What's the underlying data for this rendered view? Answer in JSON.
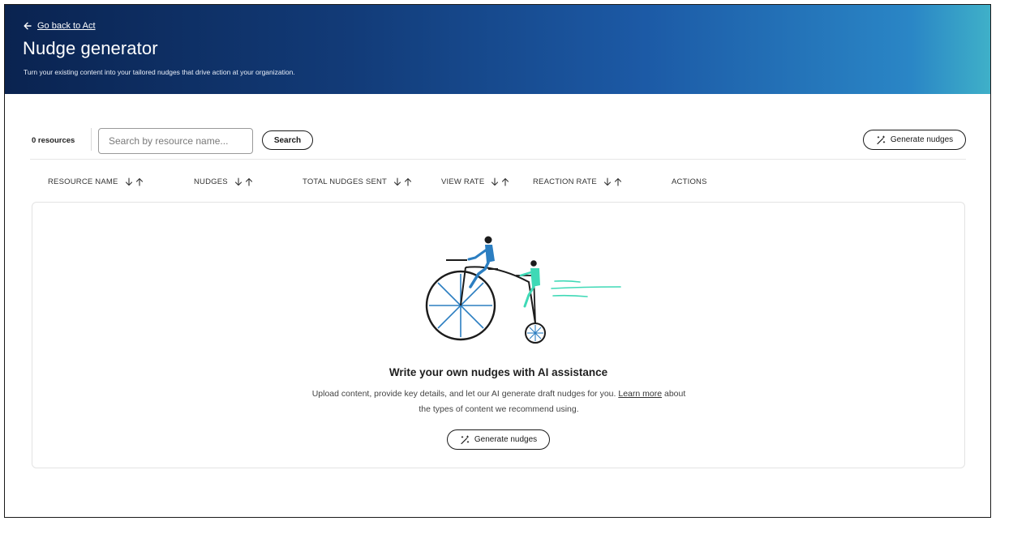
{
  "header": {
    "back_link": "Go back to Act",
    "title": "Nudge generator",
    "subtitle": "Turn your existing content into your tailored nudges that drive action at your organization."
  },
  "toolbar": {
    "resource_count": "0 resources",
    "search_placeholder": "Search by resource name...",
    "search_button": "Search",
    "generate_button": "Generate nudges"
  },
  "table": {
    "columns": [
      "RESOURCE NAME",
      "NUDGES",
      "TOTAL NUDGES SENT",
      "VIEW RATE",
      "REACTION RATE",
      "ACTIONS"
    ]
  },
  "empty_state": {
    "title": "Write your own nudges with AI assistance",
    "body_part1": "Upload content, provide key details, and let our AI generate draft nudges for you. ",
    "learn_more": "Learn more",
    "body_part2": " about the types of content we recommend using.",
    "generate_button": "Generate nudges"
  },
  "icons": {
    "back": "arrow-left-icon",
    "sort_desc": "arrow-down-icon",
    "sort_asc": "arrow-up-icon",
    "generate": "magic-wand-icon"
  },
  "colors": {
    "hero_gradient_start": "#0a2350",
    "hero_gradient_end": "#3fb0c8",
    "illustration_blue": "#2b7ec1",
    "illustration_teal": "#3fd9b6"
  }
}
